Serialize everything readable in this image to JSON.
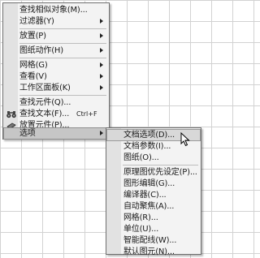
{
  "main_menu": {
    "items": [
      {
        "label": "查找相似对象(M)..."
      },
      {
        "label": "过滤器(Y)"
      },
      {
        "label": "放置(P)"
      },
      {
        "label": "图纸动作(H)"
      },
      {
        "label": "网格(G)"
      },
      {
        "label": "查看(V)"
      },
      {
        "label": "工作区面板(K)"
      },
      {
        "label": "查找元件(Q)..."
      },
      {
        "label": "查找文本(F)...",
        "shortcut": "Ctrl+F"
      },
      {
        "label": "放置元件(P)..."
      },
      {
        "label": "选项"
      }
    ]
  },
  "sub_menu": {
    "items": [
      {
        "label": "文档选项(D)..."
      },
      {
        "label": "文档参数(I)..."
      },
      {
        "label": "图纸(O)..."
      },
      {
        "label": "原理图优先设定(P)..."
      },
      {
        "label": "图形编辑(G)..."
      },
      {
        "label": "编译器(C)..."
      },
      {
        "label": "自动聚焦(A)..."
      },
      {
        "label": "网格(R)..."
      },
      {
        "label": "单位(U)..."
      },
      {
        "label": "智能配线(W)..."
      },
      {
        "label": "默认图元(N)..."
      }
    ]
  },
  "icons": {
    "find_text": "binoculars-icon",
    "place_component": "place-component-icon",
    "submenu_arrow": "chevron-right-icon",
    "cursor": "mouse-pointer-icon"
  }
}
